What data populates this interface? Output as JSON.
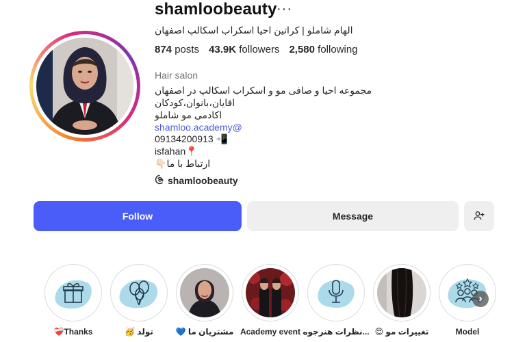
{
  "profile": {
    "username": "shamloobeauty",
    "full_name": "الهام شاملو | کراتین احیا اسکراب اسکالپ اصفهان",
    "stats": {
      "posts_count": "874",
      "posts_label": "posts",
      "followers_count": "43.9K",
      "followers_label": "followers",
      "following_count": "2,580",
      "following_label": "following"
    },
    "category": "Hair salon",
    "bio": {
      "line1": "مجموعه احیا و صافی مو و اسکراب اسکالپ در اصفهان",
      "line2": "اقایان،بانوان،کودکان",
      "line3": "اکادمی مو شاملو",
      "link": "shamloo.academy@",
      "phone": "09134200913",
      "phone_emoji": "📲",
      "city": "isfahan",
      "city_emoji": "📍",
      "contact": "ارتباط با ما",
      "contact_emoji": "👇🏻"
    },
    "threads_handle": "shamloobeauty"
  },
  "actions": {
    "follow_label": "Follow",
    "message_label": "Message"
  },
  "highlights": [
    {
      "label": "❤️‍🩹Thanks",
      "icon": "gift-icon"
    },
    {
      "label": "🥳 تولد",
      "icon": "balloons-icon"
    },
    {
      "label": "💙 مشتریان ما",
      "icon": "customer-photo"
    },
    {
      "label": "Academy event",
      "icon": "event-photo"
    },
    {
      "label": "...نظرات هنرجوه",
      "icon": "microphone-icon"
    },
    {
      "label": "😍 تغییرات مو",
      "icon": "hair-photo"
    },
    {
      "label": "Model",
      "icon": "team-stars-icon"
    }
  ],
  "colors": {
    "follow_button": "#4a5df9",
    "message_button": "#efefef",
    "link": "#4f5bd5",
    "watercolor": "#67bcd8"
  }
}
